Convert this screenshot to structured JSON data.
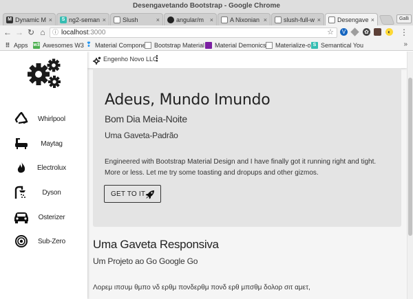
{
  "window": {
    "title": "Desengavetando Bootstrap - Google Chrome"
  },
  "tabs": [
    {
      "label": "Dynamic M",
      "favicon": "M",
      "color": "#333333"
    },
    {
      "label": "ng2-seman",
      "favicon": "S",
      "color": "#35bdb2"
    },
    {
      "label": "Slush",
      "favicon": "page",
      "color": "#ffffff"
    },
    {
      "label": "angular/m",
      "favicon": "github",
      "color": "#222222"
    },
    {
      "label": "A Nixonian",
      "favicon": "page",
      "color": "#ffffff"
    },
    {
      "label": "slush-full-w",
      "favicon": "page",
      "color": "#ffffff"
    },
    {
      "label": "Desengave",
      "favicon": "page",
      "color": "#ffffff",
      "active": true
    }
  ],
  "profile_chip": "Galli",
  "address": {
    "host": "localhost",
    "port": ":3000"
  },
  "bookmarks": [
    {
      "label": "Apps",
      "icon": "apps-grid"
    },
    {
      "label": "Awesomes W3",
      "icon": "w3",
      "color": "#4caf50"
    },
    {
      "label": "Material Compone",
      "icon": "material-pin",
      "color": "#2196f3"
    },
    {
      "label": "Bootstrap Material",
      "icon": "page"
    },
    {
      "label": "Material Demonics",
      "icon": "demonics",
      "color": "#7b1fa2"
    },
    {
      "label": "Materialize-o",
      "icon": "page"
    },
    {
      "label": "Semantical You",
      "icon": "S",
      "color": "#35bdb2"
    }
  ],
  "sidebar": {
    "items": [
      {
        "label": "Whirlpool",
        "icon": "recycle-icon"
      },
      {
        "label": "Maytag",
        "icon": "bathtub-icon"
      },
      {
        "label": "Electrolux",
        "icon": "fire-icon"
      },
      {
        "label": "Dyson",
        "icon": "shower-icon"
      },
      {
        "label": "Osterizer",
        "icon": "car-icon"
      },
      {
        "label": "Sub-Zero",
        "icon": "target-icon"
      }
    ]
  },
  "appbar": {
    "brand": "Engenho Novo LLC"
  },
  "jumbotron": {
    "title": "Adeus, Mundo Imundo",
    "subtitle": "Bom Dia Meia-Noite",
    "subtitle2": "Uma Gaveta-Padrão",
    "body": "Engineered with Bootstrap Material Design and I have finally got it running right and tight. More or less. Let me try some toasting and dropups and other gizmos.",
    "button_label": "GET TO IT"
  },
  "section": {
    "title": "Uma Gaveta Responsiva",
    "subtitle": "Um Projeto ao Go Google Go",
    "body": "Λορεμ ιπσυμ θμπο νδ ερθμ πονδερθμ πονδ ερθ μπσθμ δολορ σιτ αμετ,"
  }
}
